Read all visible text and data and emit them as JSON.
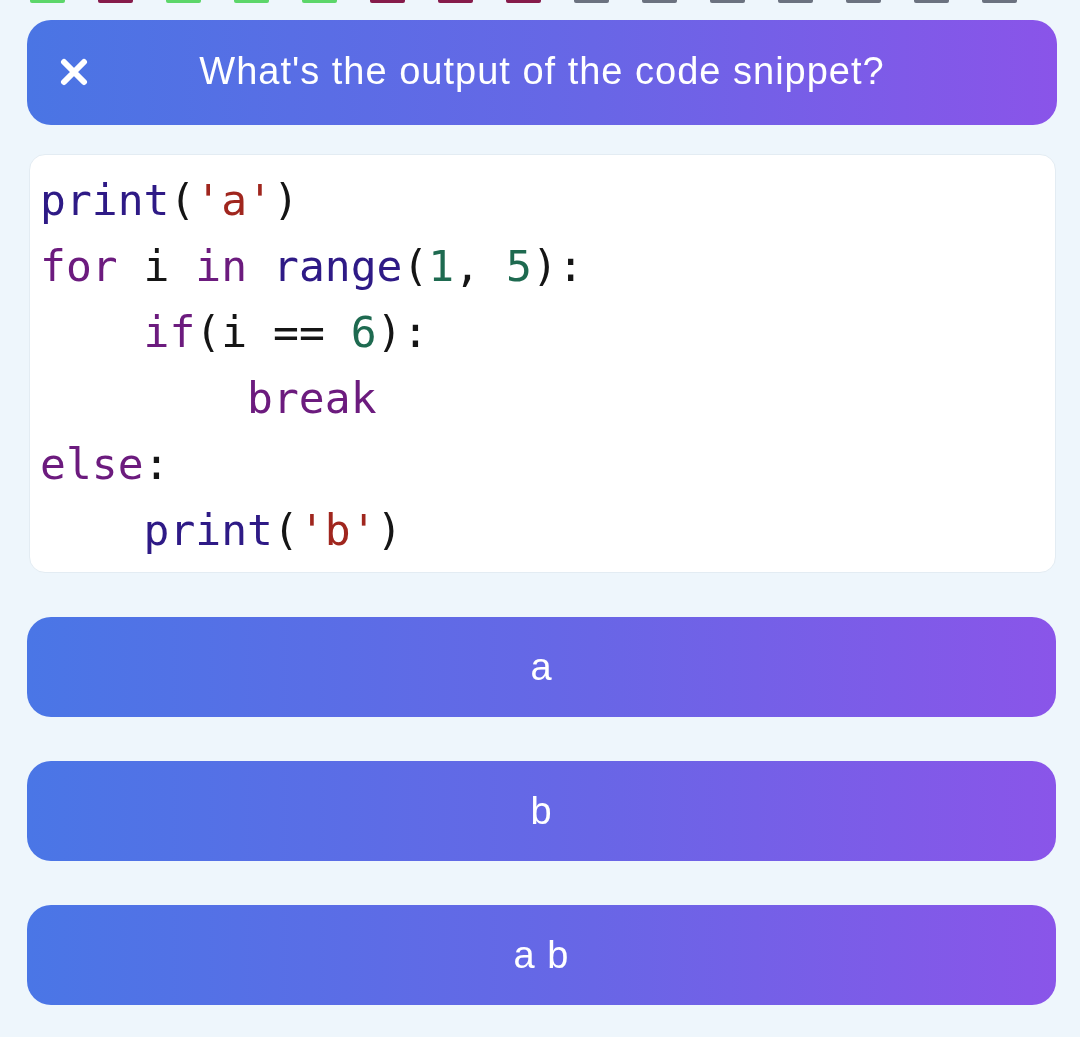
{
  "progress": [
    {
      "color": "#5cd66a"
    },
    {
      "color": "#861b4b"
    },
    {
      "color": "#5cd66a"
    },
    {
      "color": "#5cd66a"
    },
    {
      "color": "#5cd66a"
    },
    {
      "color": "#861b4b"
    },
    {
      "color": "#861b4b"
    },
    {
      "color": "#861b4b"
    },
    {
      "color": "#6b7280"
    },
    {
      "color": "#6b7280"
    },
    {
      "color": "#6b7280"
    },
    {
      "color": "#6b7280"
    },
    {
      "color": "#6b7280"
    },
    {
      "color": "#6b7280"
    },
    {
      "color": "#6b7280"
    }
  ],
  "header": {
    "title": "What's the output of the code snippet?"
  },
  "code": {
    "lines": [
      {
        "tokens": [
          {
            "text": "print",
            "kind": "builtin"
          },
          {
            "text": "(",
            "kind": "plain"
          },
          {
            "text": "'a'",
            "kind": "string"
          },
          {
            "text": ")",
            "kind": "plain"
          }
        ]
      },
      {
        "tokens": [
          {
            "text": "for",
            "kind": "keyword"
          },
          {
            "text": " i ",
            "kind": "plain"
          },
          {
            "text": "in",
            "kind": "keyword"
          },
          {
            "text": " range",
            "kind": "builtin"
          },
          {
            "text": "(",
            "kind": "plain"
          },
          {
            "text": "1",
            "kind": "number"
          },
          {
            "text": ", ",
            "kind": "plain"
          },
          {
            "text": "5",
            "kind": "number"
          },
          {
            "text": "):",
            "kind": "plain"
          }
        ],
        "children": [
          {
            "tokens": [
              {
                "text": "if",
                "kind": "keyword"
              },
              {
                "text": "(i == ",
                "kind": "plain"
              },
              {
                "text": "6",
                "kind": "number"
              },
              {
                "text": "):",
                "kind": "plain"
              }
            ],
            "children": [
              {
                "tokens": [
                  {
                    "text": "break",
                    "kind": "keyword"
                  }
                ]
              }
            ]
          }
        ]
      },
      {
        "tokens": [
          {
            "text": "else",
            "kind": "keyword"
          },
          {
            "text": ":",
            "kind": "plain"
          }
        ],
        "children": [
          {
            "tokens": [
              {
                "text": "print",
                "kind": "builtin"
              },
              {
                "text": "(",
                "kind": "plain"
              },
              {
                "text": "'b'",
                "kind": "string"
              },
              {
                "text": ")",
                "kind": "plain"
              }
            ]
          }
        ]
      }
    ]
  },
  "options": [
    {
      "label": "a",
      "selected": false
    },
    {
      "label": "b",
      "selected": false
    },
    {
      "label": "a b",
      "selected": false
    }
  ]
}
